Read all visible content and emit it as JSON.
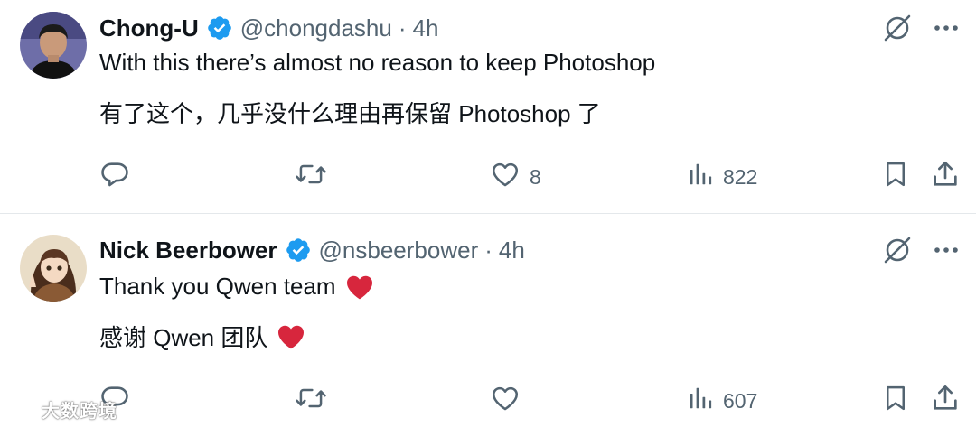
{
  "tweets": [
    {
      "author": {
        "name": "Chong-U",
        "handle": "@chongdashu",
        "time": "4h",
        "separator": "·"
      },
      "text_en": "With this there’s almost no reason to keep Photoshop",
      "text_zh": "有了这个，几乎没什么理由再保留 Photoshop 了",
      "has_heart_emoji": false,
      "stats": {
        "replies": "",
        "retweets": "",
        "likes": "8",
        "views": "822"
      }
    },
    {
      "author": {
        "name": "Nick Beerbower",
        "handle": "@nsbeerbower",
        "time": "4h",
        "separator": "·"
      },
      "text_en": "Thank you Qwen team",
      "text_zh": "感谢 Qwen 团队",
      "has_heart_emoji": true,
      "stats": {
        "replies": "",
        "retweets": "",
        "likes": "",
        "views": "607"
      }
    }
  ],
  "watermark": {
    "text": "大数跨境"
  },
  "colors": {
    "text_primary": "#0f1419",
    "text_secondary": "#536471",
    "verified_blue": "#1d9bf0",
    "heart_red": "#d7263d",
    "divider": "#e4e8eb"
  },
  "icons": {
    "verified": "verified-badge-icon",
    "grok": "grok-icon",
    "more": "more-icon",
    "reply": "reply-icon",
    "retweet": "retweet-icon",
    "like": "like-icon",
    "views": "views-icon",
    "bookmark": "bookmark-icon",
    "share": "share-icon"
  }
}
